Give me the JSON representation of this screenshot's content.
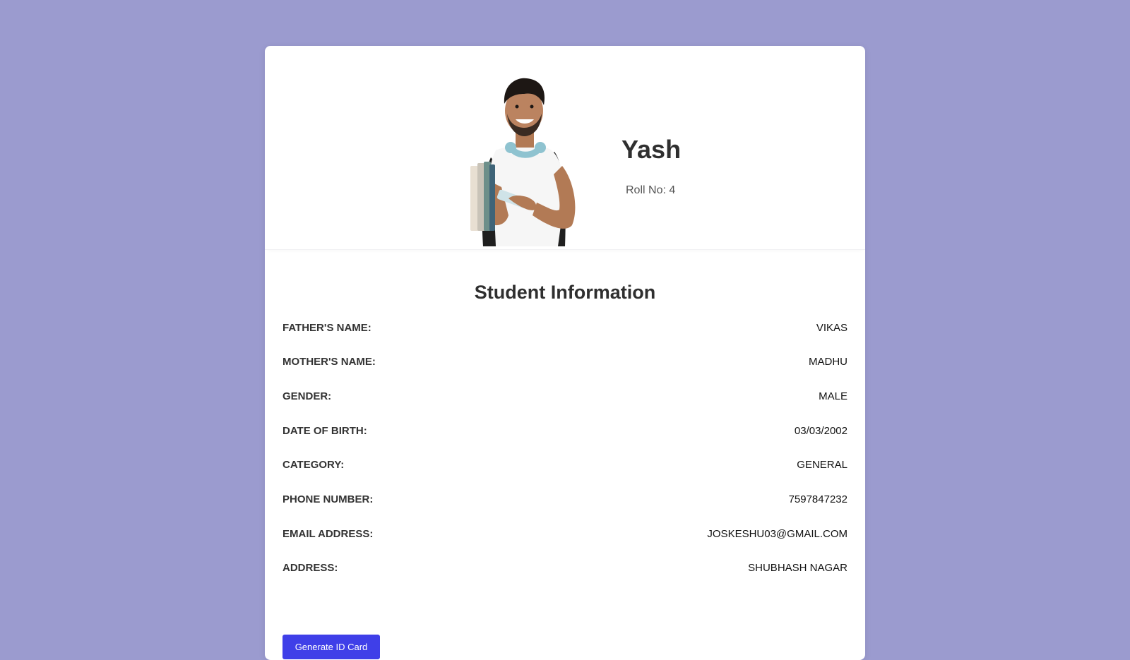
{
  "student": {
    "name": "Yash",
    "roll_label": "Roll No:",
    "roll_number": "4"
  },
  "info": {
    "title": "Student Information",
    "rows": [
      {
        "label": "FATHER'S NAME:",
        "value": "VIKAS"
      },
      {
        "label": "MOTHER'S NAME:",
        "value": "MADHU"
      },
      {
        "label": "GENDER:",
        "value": "MALE"
      },
      {
        "label": "DATE OF BIRTH:",
        "value": "03/03/2002"
      },
      {
        "label": "CATEGORY:",
        "value": "GENERAL"
      },
      {
        "label": "PHONE NUMBER:",
        "value": "7597847232"
      },
      {
        "label": "EMAIL ADDRESS:",
        "value": "JOSKESHU03@GMAIL.COM"
      },
      {
        "label": "ADDRESS:",
        "value": "SHUBHASH NAGAR"
      }
    ]
  },
  "actions": {
    "generate_label": "Generate ID Card"
  },
  "colors": {
    "background": "#9b9bcf",
    "card": "#ffffff",
    "button": "#3f3fe8"
  },
  "icons": {
    "photo": "student-photo"
  }
}
